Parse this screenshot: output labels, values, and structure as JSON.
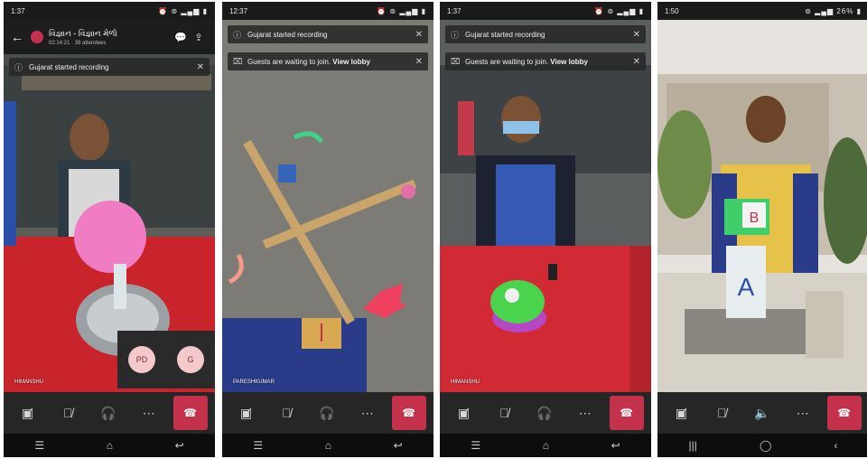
{
  "phones": [
    {
      "status_time": "1:37",
      "status_right": "⏰ ⊚ ▂▄▆ ▮",
      "header": {
        "title": "વિજ્ઞાન - વિજ્ઞાન મેળો",
        "subtitle": "02:14:21  · 39 attendees"
      },
      "banners": [
        {
          "text": "Gujarat started recording"
        }
      ],
      "name_tag": "HIMANSHU",
      "avatars": [
        "PD",
        "G"
      ]
    },
    {
      "status_time": "12:37",
      "status_right": "⏰ ⊚ ▂▄▆ ▮",
      "banners": [
        {
          "text": "Gujarat started recording"
        },
        {
          "text": "Guests are waiting to join.",
          "link": "View lobby"
        }
      ],
      "name_tag": "PARESHKUMAR"
    },
    {
      "status_time": "1:37",
      "status_right": "⏰ ⊚ ▂▄▆ ▮",
      "banners": [
        {
          "text": "Gujarat started recording"
        },
        {
          "text": "Guests are waiting to join.",
          "link": "View lobby"
        }
      ],
      "name_tag": "HIMANSHU"
    },
    {
      "status_time": "1:50",
      "status_right": "⊚ ▂▄▆ 26% ▮"
    }
  ],
  "colors": {
    "hangup": "#c4314b",
    "callbar": "#262626",
    "banner": "#282828"
  }
}
